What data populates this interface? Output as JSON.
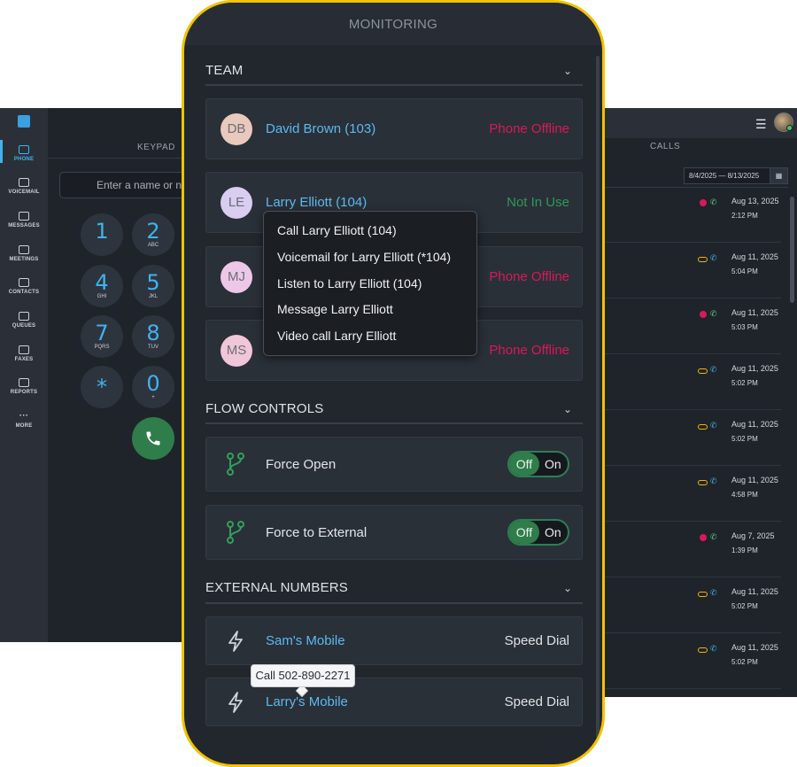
{
  "sidebar": {
    "items": [
      {
        "label": "PHONE",
        "icon": "phone-icon",
        "active": true
      },
      {
        "label": "VOICEMAIL",
        "icon": "voicemail-icon"
      },
      {
        "label": "MESSAGES",
        "icon": "messages-icon"
      },
      {
        "label": "MEETINGS",
        "icon": "meetings-icon"
      },
      {
        "label": "CONTACTS",
        "icon": "contacts-icon"
      },
      {
        "label": "QUEUES",
        "icon": "queues-icon"
      },
      {
        "label": "FAXES",
        "icon": "faxes-icon"
      },
      {
        "label": "REPORTS",
        "icon": "reports-icon"
      },
      {
        "label": "MORE",
        "icon": "more-icon"
      }
    ]
  },
  "keypad": {
    "title": "KEYPAD",
    "input_placeholder": "Enter a name or nu",
    "keys": [
      {
        "digit": "1",
        "letters": ""
      },
      {
        "digit": "2",
        "letters": "ABC"
      },
      {
        "digit": "4",
        "letters": "GHI"
      },
      {
        "digit": "5",
        "letters": "JKL"
      },
      {
        "digit": "7",
        "letters": "PQRS"
      },
      {
        "digit": "8",
        "letters": "TUV"
      },
      {
        "digit": "*",
        "letters": ""
      },
      {
        "digit": "0",
        "letters": "+"
      }
    ]
  },
  "calls": {
    "title": "CALLS",
    "date_range": "8/4/2025 — 8/13/2025",
    "rows": [
      {
        "date": "Aug 13, 2025",
        "time": "2:12 PM",
        "type": "missed"
      },
      {
        "date": "Aug 11, 2025",
        "time": "5:04 PM",
        "type": "voicemail"
      },
      {
        "date": "Aug 11, 2025",
        "time": "5:03 PM",
        "type": "missed"
      },
      {
        "date": "Aug 11, 2025",
        "time": "5:02 PM",
        "type": "voicemail"
      },
      {
        "date": "Aug 11, 2025",
        "time": "5:02 PM",
        "type": "voicemail"
      },
      {
        "date": "Aug 11, 2025",
        "time": "4:58 PM",
        "type": "voicemail"
      },
      {
        "date": "Aug 7, 2025",
        "time": "1:39 PM",
        "type": "missed"
      },
      {
        "date": "Aug 11, 2025",
        "time": "5:02 PM",
        "type": "voicemail"
      },
      {
        "date": "Aug 11, 2025",
        "time": "5:02 PM",
        "type": "voicemail"
      }
    ]
  },
  "monitoring": {
    "title": "MONITORING",
    "team": {
      "title": "TEAM",
      "members": [
        {
          "initials": "DB",
          "name": "David Brown (103)",
          "status": "Phone Offline",
          "status_color": "#d8195a",
          "avatar_color": "#e8c9bb"
        },
        {
          "initials": "LE",
          "name": "Larry Elliott (104)",
          "status": "Not In Use",
          "status_color": "#2e9a57",
          "avatar_color": "#d9cdf0"
        },
        {
          "initials": "MJ",
          "name": "",
          "status": "Phone Offline",
          "status_color": "#d8195a",
          "avatar_color": "#edc7e8"
        },
        {
          "initials": "MS",
          "name": "",
          "status": "Phone Offline",
          "status_color": "#d8195a",
          "avatar_color": "#f0c6d8"
        }
      ]
    },
    "context_menu": [
      "Call Larry Elliott (104)",
      "Voicemail for Larry Elliott (*104)",
      "Listen to Larry Elliott (104)",
      "Message Larry Elliott",
      "Video call Larry Elliott"
    ],
    "flow_controls": {
      "title": "FLOW CONTROLS",
      "items": [
        {
          "label": "Force Open",
          "off_label": "Off",
          "on_label": "On",
          "state": "off"
        },
        {
          "label": "Force to External",
          "off_label": "Off",
          "on_label": "On",
          "state": "off"
        }
      ]
    },
    "external_numbers": {
      "title": "EXTERNAL NUMBERS",
      "items": [
        {
          "name": "Sam's Mobile",
          "type": "Speed Dial"
        },
        {
          "name": "Larry's Mobile",
          "type": "Speed Dial"
        }
      ]
    },
    "tooltip": "Call 502-890-2271"
  },
  "colors": {
    "accent": "#3fb3ee",
    "frame": "#f2c200",
    "offline": "#d8195a",
    "available": "#2e9a57"
  }
}
